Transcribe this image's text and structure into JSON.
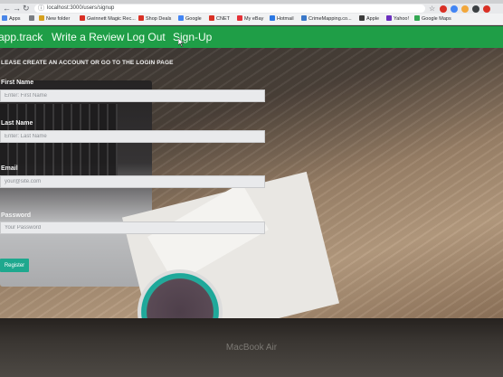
{
  "browser": {
    "url": "localhost:3000/users/signup",
    "bookmarks": [
      "Apps",
      "New folder",
      "Gwinnett Magic Rec...",
      "Shop Deals",
      "Google",
      "CNET",
      "My eBay",
      "Hotmail",
      "CrimeMapping.co...",
      "Apple",
      "Yahoo!",
      "Google Maps"
    ],
    "bookmark_colors": [
      "#4a86e8",
      "#7a7d82",
      "#d6a11e",
      "#d93025",
      "#4285f4",
      "#d93025",
      "#e53238",
      "#2b78e4",
      "#3b79c9",
      "#3c3c3c",
      "#6b2fbf",
      "#34a853"
    ],
    "extension_colors": [
      "#d93025",
      "#4285f4",
      "#f2a73b",
      "#3c4043",
      "#d93025"
    ]
  },
  "nav": {
    "brand": "app.track",
    "links": [
      "Write a Review",
      "Log Out",
      "Sign-Up"
    ]
  },
  "form": {
    "heading": "LEASE CREATE AN ACCOUNT OR GO TO THE LOGIN PAGE",
    "first_name_label": "First Name",
    "first_name_placeholder": "Enter: First Name",
    "last_name_label": "Last Name",
    "last_name_placeholder": "Enter: Last Name",
    "email_label": "Email",
    "email_placeholder": "your@site.com",
    "password_label": "Password",
    "password_placeholder": "Your Password",
    "submit_label": "Register"
  },
  "device": {
    "brand": "MacBook Air"
  },
  "colors": {
    "nav_bg": "#1f9e47",
    "button_bg": "#1ea88e"
  }
}
